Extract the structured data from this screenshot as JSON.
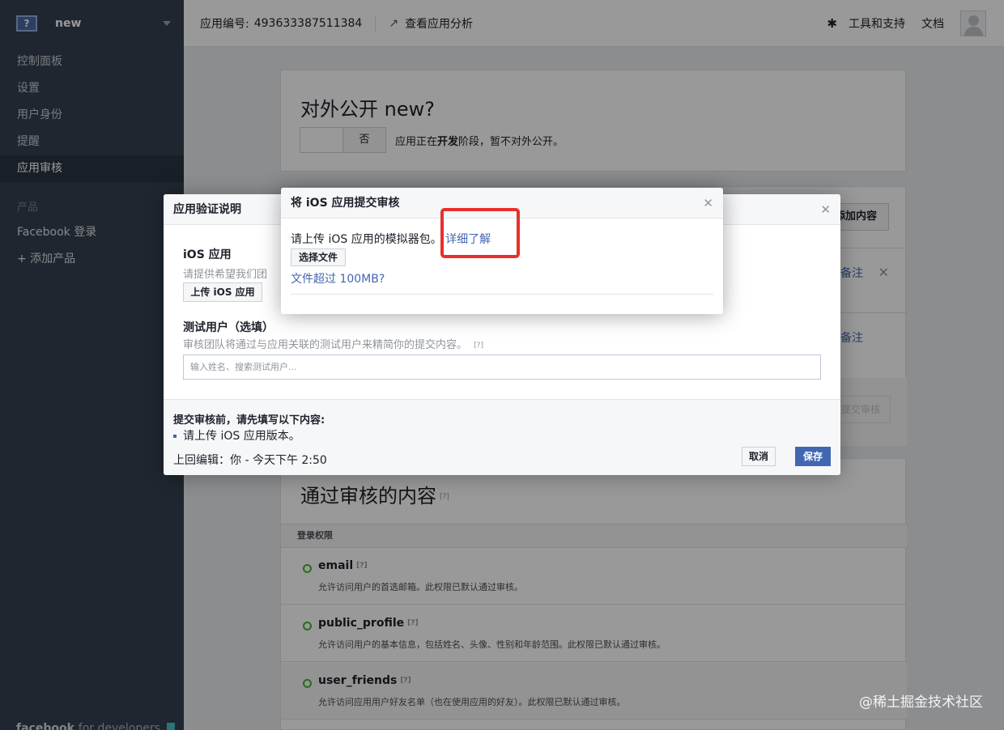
{
  "sidebar": {
    "app_name": "new",
    "app_icon": "?",
    "nav": [
      "控制面板",
      "设置",
      "用户身份",
      "提醒",
      "应用审核"
    ],
    "section_label": "产品",
    "products": [
      "Facebook 登录",
      "+ 添加产品"
    ],
    "footer_brand": "facebook",
    "footer_sub": "for developers"
  },
  "topbar": {
    "app_id_label": "应用编号:",
    "app_id": "493633387511384",
    "analytics_link": "查看应用分析",
    "tools_link": "工具和支持",
    "docs_link": "文档"
  },
  "main": {
    "public_title": "对外公开 new?",
    "toggle_label": "否",
    "public_desc_prefix": "应用正在",
    "public_desc_bold": "开发",
    "public_desc_suffix": "阶段，暂不对外公开。",
    "add_content_button": "添加内容",
    "note_link_1": "备注",
    "note_link_2": "备注",
    "submit_button": "提交审核",
    "approved_title": "通过审核的内容",
    "qmark": "[?]",
    "login_perms_header": "登录权限",
    "permissions": [
      {
        "name": "email",
        "desc": "允许访问用户的首选邮箱。此权限已默认通过审核。"
      },
      {
        "name": "public_profile",
        "desc": "允许访问用户的基本信息，包括姓名、头像、性别和年龄范围。此权限已默认通过审核。"
      },
      {
        "name": "user_friends",
        "desc": "允许访问应用用户好友名单（也在使用应用的好友）。此权限已默认通过审核。"
      }
    ]
  },
  "back_dialog": {
    "title": "应用验证说明",
    "ios_title": "iOS 应用",
    "ios_desc": "请提供希望我们团",
    "upload_button": "上传 iOS 应用",
    "tester_title": "测试用户（选填）",
    "tester_desc": "审核团队将通过与应用关联的测试用户来精简你的提交内容。",
    "tester_qmark": "[?]",
    "tester_placeholder": "输入姓名、搜索测试用户...",
    "footer_title": "提交审核前，请先填写以下内容:",
    "footer_item": "请上传 iOS 应用版本。",
    "last_edited": "上回编辑：你 - 今天下午 2:50",
    "cancel_button": "取消",
    "save_button": "保存"
  },
  "front_dialog": {
    "title": "将 iOS 应用提交审核",
    "body_text": "请上传 iOS 应用的模拟器包。",
    "learn_more": "详细了解",
    "choose_file_button": "选择文件",
    "size_link": "文件超过 100MB?"
  },
  "watermark": "@稀土掘金技术社区",
  "colors": {
    "accent": "#4267b2",
    "highlight": "#e8302a",
    "sidebar": "#35404f"
  }
}
